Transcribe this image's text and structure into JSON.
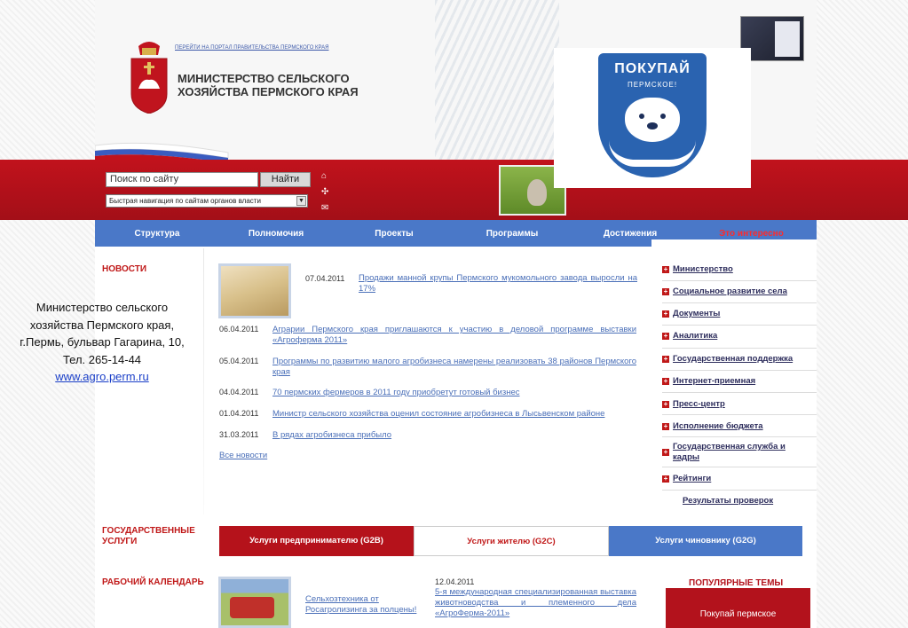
{
  "header": {
    "portal_link": "ПЕРЕЙТИ НА ПОРТАЛ ПРАВИТЕЛЬСТВА ПЕРМСКОГО КРАЯ",
    "title_line1": "МИНИСТЕРСТВО СЕЛЬСКОГО",
    "title_line2": "ХОЗЯЙСТВА ПЕРМСКОГО КРАЯ"
  },
  "search": {
    "value": "Поиск по сайту",
    "button_label": "Найти",
    "quick_nav": "Быстрая навигация по сайтам органов власти"
  },
  "promo": {
    "title": "ПОКУПАЙ",
    "subtitle": "ПЕРМСКОЕ!"
  },
  "nav": {
    "items": [
      "Структура",
      "Полномочия",
      "Проекты",
      "Программы",
      "Достижения",
      "Это интересно"
    ]
  },
  "sections": {
    "news": "НОВОСТИ",
    "gov_services_line1": "ГОСУДАРСТВЕННЫЕ",
    "gov_services_line2": "УСЛУГИ",
    "calendar": "РАБОЧИЙ КАЛЕНДАРЬ",
    "popular": "ПОПУЛЯРНЫЕ ТЕМЫ"
  },
  "news": [
    {
      "date": "07.04.2011",
      "title": "Продажи манной крупы Пермского мукомольного завода выросли на 17%"
    },
    {
      "date": "06.04.2011",
      "title": "Аграрии Пермского края приглашаются к участию в деловой программе выставки «Агроферма 2011»"
    },
    {
      "date": "05.04.2011",
      "title": "Программы по развитию малого агробизнеса намерены реализовать 38 районов Пермского края"
    },
    {
      "date": "04.04.2011",
      "title": "70 пермских фермеров в 2011 году приобретут готовый бизнес"
    },
    {
      "date": "01.04.2011",
      "title": "Министр сельского хозяйства оценил состояние агробизнеса в Лысьвенском районе"
    },
    {
      "date": "31.03.2011",
      "title": "В рядах агробизнеса прибыло"
    }
  ],
  "all_news": "Все новости",
  "right_menu": [
    "Министерство",
    "Социальное развитие села",
    "Документы",
    "Аналитика",
    "Государственная поддержка",
    "Интернет-приемная",
    "Пресс-центр",
    "Исполнение бюджета",
    "Государственная служба и кадры",
    "Рейтинги"
  ],
  "checks_link": "Результаты проверок",
  "services": {
    "g2b": "Услуги предпринимателю (G2B)",
    "g2c": "Услуги жителю (G2C)",
    "g2g": "Услуги чиновнику (G2G)"
  },
  "calendar": {
    "link": "Сельхозтехника от Росагролизинга за полцены!",
    "date": "12.04.2011",
    "event": "5-я международная специализированная выставка животноводства и племенного дела «АгроФерма-2011»"
  },
  "popular_box": "Покупай пермское",
  "contact": {
    "line1": "Министерство сельского",
    "line2": "хозяйства Пермского края,",
    "line3": "г.Пермь, бульвар Гагарина, 10,",
    "line4": "Тел. 265-14-44",
    "url": "www.agro.perm.ru"
  },
  "colors": {
    "red": "#c1121c",
    "blue_nav": "#4a78c8",
    "link": "#4a6fb8"
  }
}
